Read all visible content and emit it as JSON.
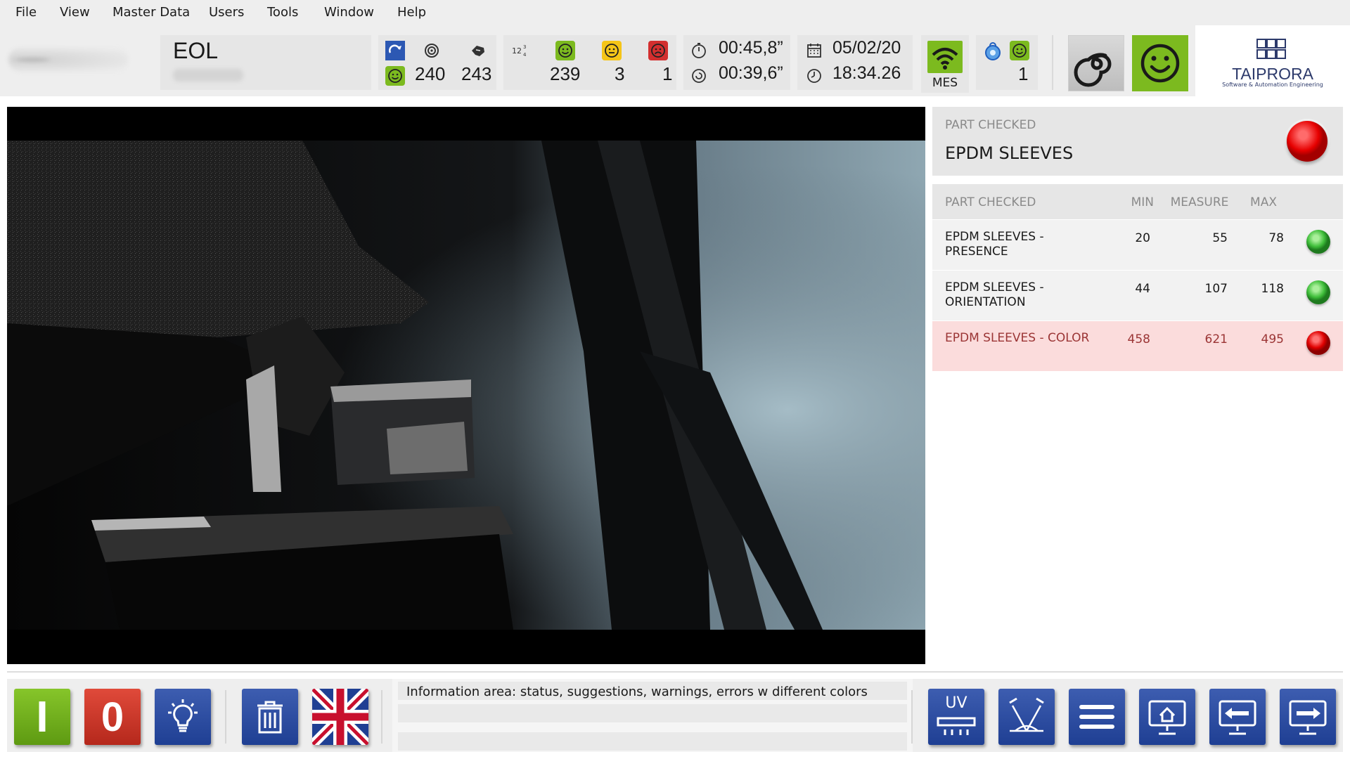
{
  "menu": [
    "File",
    "View",
    "Master Data",
    "Users",
    "Tools",
    "Window",
    "Help"
  ],
  "station": {
    "name": "EOL"
  },
  "counters": {
    "total_a": "240",
    "total_b": "243",
    "good": "239",
    "warning": "3",
    "bad": "1"
  },
  "times": {
    "cycle": "00:45,8”",
    "avg": "00:39,6”"
  },
  "datetime": {
    "date": "05/02/20",
    "time": "18:34.26"
  },
  "mes": {
    "label": "MES"
  },
  "operators": {
    "count": "1"
  },
  "brand": {
    "name": "TAIPRORA",
    "tagline": "Software & Automation Engineering"
  },
  "result": {
    "label": "PART CHECKED",
    "value": "EPDM SLEEVES",
    "status": "fail"
  },
  "table": {
    "headers": {
      "name": "PART CHECKED",
      "min": "MIN",
      "measure": "MEASURE",
      "max": "MAX"
    },
    "rows": [
      {
        "name": "EPDM SLEEVES - PRESENCE",
        "min": "20",
        "measure": "55",
        "max": "78",
        "status": "ok"
      },
      {
        "name": "EPDM SLEEVES - ORIENTATION",
        "min": "44",
        "measure": "107",
        "max": "118",
        "status": "ok"
      },
      {
        "name": "EPDM SLEEVES - COLOR",
        "min": "458",
        "measure": "621",
        "max": "495",
        "status": "fail"
      }
    ]
  },
  "toolbar": {
    "on": "I",
    "off": "0",
    "uv": "UV"
  },
  "info": {
    "text": "Information area: status, suggestions, warnings, errors w different colors"
  },
  "colors": {
    "accent_blue": "#1f3f93",
    "green": "#7cba1f",
    "red": "#d32f2f",
    "yellow": "#f5c518"
  },
  "icons": [
    "cycle-icon",
    "smiley-good-icon",
    "target-icon",
    "hand-icon",
    "counter-icon",
    "smiley-warn-icon",
    "smiley-bad-icon",
    "stopwatch-icon",
    "spiral-icon",
    "calendar-icon",
    "clock-icon",
    "wifi-icon",
    "keyfob-icon",
    "lightbulb-icon",
    "trash-icon",
    "uk-flag-icon",
    "menu-icon",
    "home-screen-icon",
    "back-icon",
    "forward-icon"
  ]
}
